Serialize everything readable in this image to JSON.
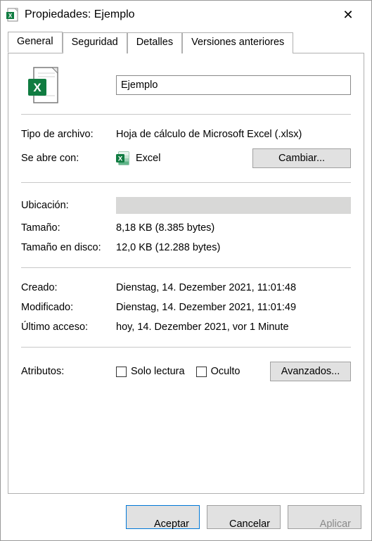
{
  "window": {
    "title": "Propiedades: Ejemplo"
  },
  "tabs": {
    "general": "General",
    "security": "Seguridad",
    "details": "Detalles",
    "previous": "Versiones anteriores"
  },
  "file": {
    "name": "Ejemplo"
  },
  "labels": {
    "filetype": "Tipo de archivo:",
    "openswith": "Se abre con:",
    "change": "Cambiar...",
    "location": "Ubicación:",
    "size": "Tamaño:",
    "sizeondisk": "Tamaño en disco:",
    "created": "Creado:",
    "modified": "Modificado:",
    "accessed": "Último acceso:",
    "attributes": "Atributos:",
    "readonly": "Solo lectura",
    "hidden": "Oculto",
    "advanced": "Avanzados..."
  },
  "values": {
    "filetype": "Hoja de cálculo de Microsoft Excel (.xlsx)",
    "openswith_app": "Excel",
    "location": "",
    "size": "8,18 KB (8.385 bytes)",
    "sizeondisk": "12,0 KB (12.288 bytes)",
    "created": "Dienstag, 14. Dezember 2021, 11:01:48",
    "modified": "Dienstag, 14. Dezember 2021, 11:01:49",
    "accessed": "hoy, 14. Dezember 2021, vor 1 Minute"
  },
  "footer": {
    "ok": "Aceptar",
    "cancel": "Cancelar",
    "apply": "Aplicar"
  }
}
